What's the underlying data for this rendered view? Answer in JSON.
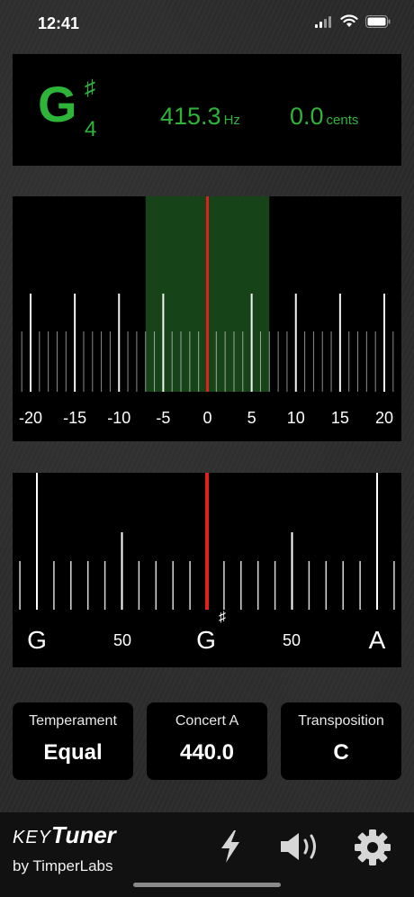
{
  "status": {
    "time": "12:41"
  },
  "readout": {
    "note": "G",
    "accidental": "♯",
    "octave": "4",
    "frequency": "415.3",
    "frequency_unit": "Hz",
    "cents": "0.0",
    "cents_unit": "cents"
  },
  "meter": {
    "labels": [
      "-20",
      "-15",
      "-10",
      "-5",
      "0",
      "5",
      "10",
      "15",
      "20"
    ],
    "needle_cents": 0,
    "in_tune_range_cents": [
      -7,
      7
    ]
  },
  "strobe": {
    "left_note": "G",
    "left_num": "50",
    "center_note": "G",
    "center_accidental": "♯",
    "right_num": "50",
    "right_note": "A"
  },
  "settings": {
    "temperament": {
      "label": "Temperament",
      "value": "Equal"
    },
    "concert_a": {
      "label": "Concert A",
      "value": "440.0"
    },
    "transposition": {
      "label": "Transposition",
      "value": "C"
    }
  },
  "brand": {
    "key": "KEY",
    "tuner": "Tuner",
    "by": "by TimperLabs"
  },
  "icons": {
    "flash": "lightning-icon",
    "sound": "speaker-icon",
    "settings": "gear-icon"
  },
  "colors": {
    "accent_green": "#2fb43a",
    "needle_red": "#e0201c"
  }
}
